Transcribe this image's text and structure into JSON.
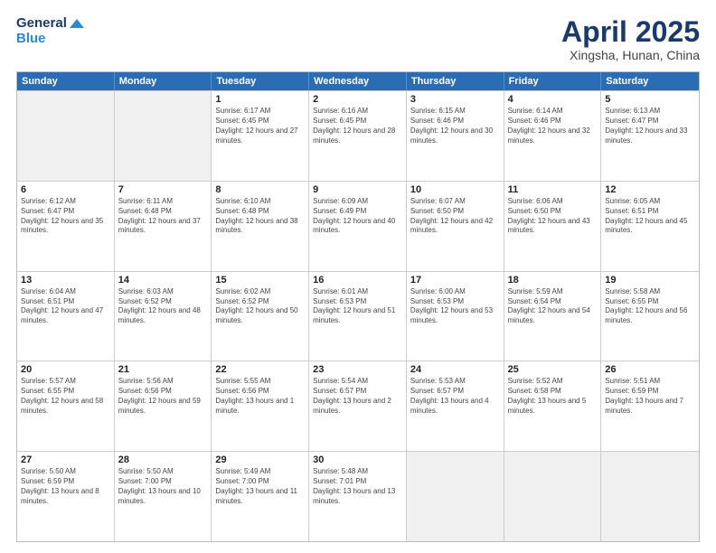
{
  "header": {
    "logo_line1": "General",
    "logo_line2": "Blue",
    "title": "April 2025",
    "subtitle": "Xingsha, Hunan, China"
  },
  "days": [
    "Sunday",
    "Monday",
    "Tuesday",
    "Wednesday",
    "Thursday",
    "Friday",
    "Saturday"
  ],
  "weeks": [
    [
      {
        "day": "",
        "info": "",
        "shaded": true
      },
      {
        "day": "",
        "info": "",
        "shaded": true
      },
      {
        "day": "1",
        "info": "Sunrise: 6:17 AM\nSunset: 6:45 PM\nDaylight: 12 hours and 27 minutes.",
        "shaded": false
      },
      {
        "day": "2",
        "info": "Sunrise: 6:16 AM\nSunset: 6:45 PM\nDaylight: 12 hours and 28 minutes.",
        "shaded": false
      },
      {
        "day": "3",
        "info": "Sunrise: 6:15 AM\nSunset: 6:46 PM\nDaylight: 12 hours and 30 minutes.",
        "shaded": false
      },
      {
        "day": "4",
        "info": "Sunrise: 6:14 AM\nSunset: 6:46 PM\nDaylight: 12 hours and 32 minutes.",
        "shaded": false
      },
      {
        "day": "5",
        "info": "Sunrise: 6:13 AM\nSunset: 6:47 PM\nDaylight: 12 hours and 33 minutes.",
        "shaded": false
      }
    ],
    [
      {
        "day": "6",
        "info": "Sunrise: 6:12 AM\nSunset: 6:47 PM\nDaylight: 12 hours and 35 minutes.",
        "shaded": false
      },
      {
        "day": "7",
        "info": "Sunrise: 6:11 AM\nSunset: 6:48 PM\nDaylight: 12 hours and 37 minutes.",
        "shaded": false
      },
      {
        "day": "8",
        "info": "Sunrise: 6:10 AM\nSunset: 6:48 PM\nDaylight: 12 hours and 38 minutes.",
        "shaded": false
      },
      {
        "day": "9",
        "info": "Sunrise: 6:09 AM\nSunset: 6:49 PM\nDaylight: 12 hours and 40 minutes.",
        "shaded": false
      },
      {
        "day": "10",
        "info": "Sunrise: 6:07 AM\nSunset: 6:50 PM\nDaylight: 12 hours and 42 minutes.",
        "shaded": false
      },
      {
        "day": "11",
        "info": "Sunrise: 6:06 AM\nSunset: 6:50 PM\nDaylight: 12 hours and 43 minutes.",
        "shaded": false
      },
      {
        "day": "12",
        "info": "Sunrise: 6:05 AM\nSunset: 6:51 PM\nDaylight: 12 hours and 45 minutes.",
        "shaded": false
      }
    ],
    [
      {
        "day": "13",
        "info": "Sunrise: 6:04 AM\nSunset: 6:51 PM\nDaylight: 12 hours and 47 minutes.",
        "shaded": false
      },
      {
        "day": "14",
        "info": "Sunrise: 6:03 AM\nSunset: 6:52 PM\nDaylight: 12 hours and 48 minutes.",
        "shaded": false
      },
      {
        "day": "15",
        "info": "Sunrise: 6:02 AM\nSunset: 6:52 PM\nDaylight: 12 hours and 50 minutes.",
        "shaded": false
      },
      {
        "day": "16",
        "info": "Sunrise: 6:01 AM\nSunset: 6:53 PM\nDaylight: 12 hours and 51 minutes.",
        "shaded": false
      },
      {
        "day": "17",
        "info": "Sunrise: 6:00 AM\nSunset: 6:53 PM\nDaylight: 12 hours and 53 minutes.",
        "shaded": false
      },
      {
        "day": "18",
        "info": "Sunrise: 5:59 AM\nSunset: 6:54 PM\nDaylight: 12 hours and 54 minutes.",
        "shaded": false
      },
      {
        "day": "19",
        "info": "Sunrise: 5:58 AM\nSunset: 6:55 PM\nDaylight: 12 hours and 56 minutes.",
        "shaded": false
      }
    ],
    [
      {
        "day": "20",
        "info": "Sunrise: 5:57 AM\nSunset: 6:55 PM\nDaylight: 12 hours and 58 minutes.",
        "shaded": false
      },
      {
        "day": "21",
        "info": "Sunrise: 5:56 AM\nSunset: 6:56 PM\nDaylight: 12 hours and 59 minutes.",
        "shaded": false
      },
      {
        "day": "22",
        "info": "Sunrise: 5:55 AM\nSunset: 6:56 PM\nDaylight: 13 hours and 1 minute.",
        "shaded": false
      },
      {
        "day": "23",
        "info": "Sunrise: 5:54 AM\nSunset: 6:57 PM\nDaylight: 13 hours and 2 minutes.",
        "shaded": false
      },
      {
        "day": "24",
        "info": "Sunrise: 5:53 AM\nSunset: 6:57 PM\nDaylight: 13 hours and 4 minutes.",
        "shaded": false
      },
      {
        "day": "25",
        "info": "Sunrise: 5:52 AM\nSunset: 6:58 PM\nDaylight: 13 hours and 5 minutes.",
        "shaded": false
      },
      {
        "day": "26",
        "info": "Sunrise: 5:51 AM\nSunset: 6:59 PM\nDaylight: 13 hours and 7 minutes.",
        "shaded": false
      }
    ],
    [
      {
        "day": "27",
        "info": "Sunrise: 5:50 AM\nSunset: 6:59 PM\nDaylight: 13 hours and 8 minutes.",
        "shaded": false
      },
      {
        "day": "28",
        "info": "Sunrise: 5:50 AM\nSunset: 7:00 PM\nDaylight: 13 hours and 10 minutes.",
        "shaded": false
      },
      {
        "day": "29",
        "info": "Sunrise: 5:49 AM\nSunset: 7:00 PM\nDaylight: 13 hours and 11 minutes.",
        "shaded": false
      },
      {
        "day": "30",
        "info": "Sunrise: 5:48 AM\nSunset: 7:01 PM\nDaylight: 13 hours and 13 minutes.",
        "shaded": false
      },
      {
        "day": "",
        "info": "",
        "shaded": true
      },
      {
        "day": "",
        "info": "",
        "shaded": true
      },
      {
        "day": "",
        "info": "",
        "shaded": true
      }
    ]
  ]
}
